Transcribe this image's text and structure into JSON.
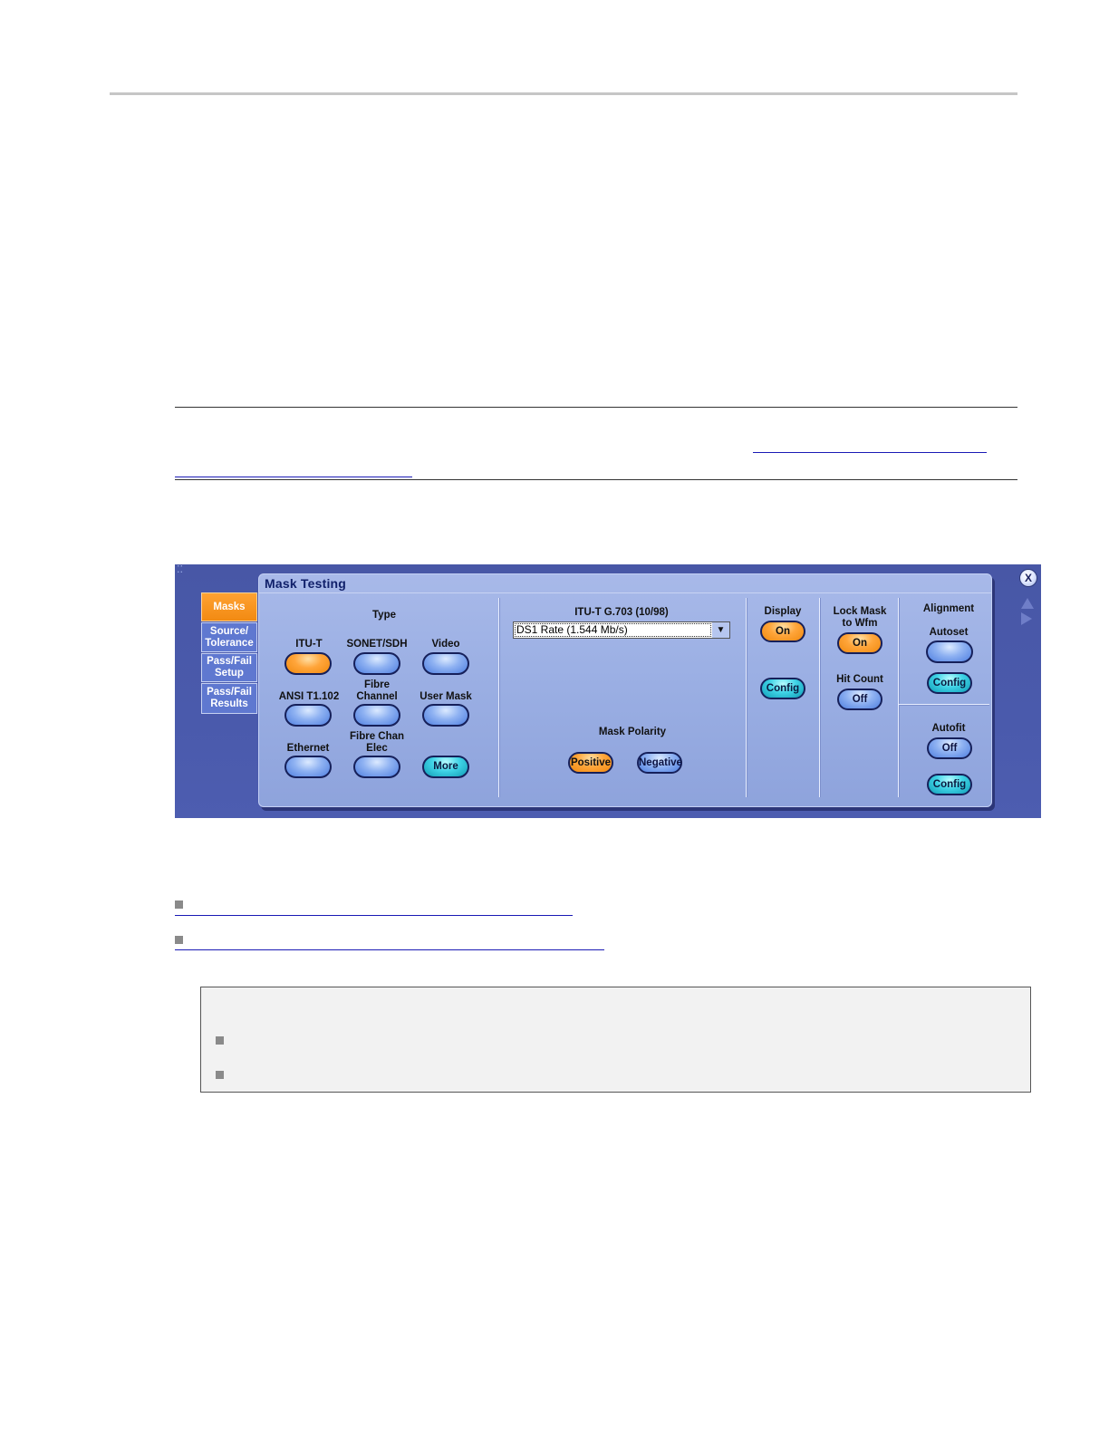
{
  "panel": {
    "title": "Mask Testing",
    "close_label": "X",
    "tabs": [
      {
        "label": "Masks",
        "active": true
      },
      {
        "label": "Source/ Tolerance",
        "active": false
      },
      {
        "label": "Pass/Fail Setup",
        "active": false
      },
      {
        "label": "Pass/Fail Results",
        "active": false
      }
    ],
    "type_section": {
      "label": "Type",
      "buttons": [
        {
          "label": "ITU-T",
          "selected": true
        },
        {
          "label": "SONET/SDH",
          "selected": false
        },
        {
          "label": "Video",
          "selected": false
        },
        {
          "label": "ANSI T1.102",
          "selected": false
        },
        {
          "label": "Fibre Channel",
          "selected": false
        },
        {
          "label": "User Mask",
          "selected": false
        },
        {
          "label": "Ethernet",
          "selected": false
        },
        {
          "label": "Fibre Chan Elec",
          "selected": false
        }
      ],
      "more_label": "More"
    },
    "standard": {
      "label": "ITU-T G.703 (10/98)",
      "selected_value": "DS1 Rate (1.544 Mb/s)",
      "dropdown_arrow": "▼"
    },
    "mask_polarity": {
      "label": "Mask Polarity",
      "positive_label": "Positive",
      "negative_label": "Negative",
      "selected": "Positive"
    },
    "display": {
      "label": "Display",
      "state": "On",
      "config_label": "Config"
    },
    "lock_mask": {
      "label_line1": "Lock Mask",
      "label_line2": "to Wfm",
      "state": "On"
    },
    "hit_count": {
      "label": "Hit Count",
      "state": "Off"
    },
    "alignment": {
      "label": "Alignment",
      "autoset_label": "Autoset",
      "config_label": "Config",
      "autofit_label": "Autofit",
      "autofit_state": "Off",
      "autofit_config_label": "Config"
    }
  },
  "colors": {
    "panel_background": "#4a5aac",
    "card_background": "#9cb0e4",
    "selected_orange": "#f28a12",
    "button_blue": "#6f97ea",
    "button_teal": "#2bbcd4",
    "link_underline": "#1a1ab5"
  },
  "icons": {
    "close": "close-icon",
    "nav_up": "triangle-up-icon",
    "nav_right": "triangle-right-icon",
    "dropdown": "chevron-down-icon",
    "bullet": "square-bullet-icon",
    "grip": "grip-icon"
  }
}
